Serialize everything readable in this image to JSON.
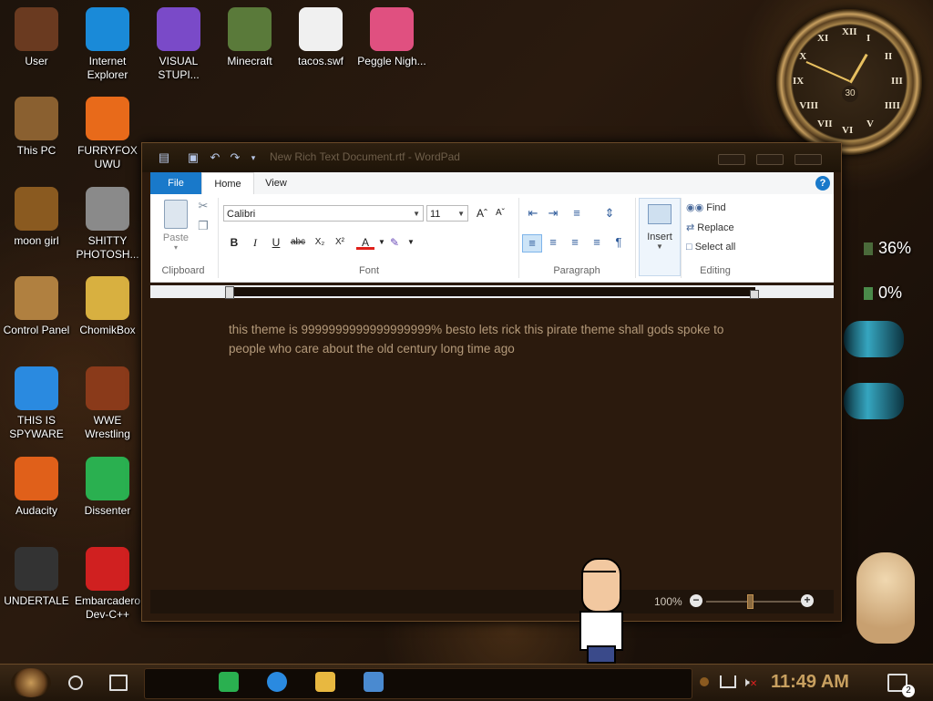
{
  "desktop_icons": [
    {
      "label": "User",
      "icon": "user-folder-icon",
      "color": "#6a3a20"
    },
    {
      "label": "Internet Explorer",
      "icon": "edge-browser-icon",
      "color": "#1a8ad8"
    },
    {
      "label": "VISUAL STUPI...",
      "icon": "visual-studio-icon",
      "color": "#7a4ac8"
    },
    {
      "label": "Minecraft",
      "icon": "minecraft-icon",
      "color": "#5a7a3a"
    },
    {
      "label": "tacos.swf",
      "icon": "flash-file-icon",
      "color": "#f0f0f0"
    },
    {
      "label": "Peggle Nigh...",
      "icon": "peggle-icon",
      "color": "#e05080"
    },
    {
      "label": "This PC",
      "icon": "computer-icon",
      "color": "#8a6030"
    },
    {
      "label": "FURRYFOX UWU",
      "icon": "firefox-icon",
      "color": "#e86a1a"
    },
    {
      "label": "moon girl",
      "icon": "folder-icon",
      "color": "#8a5a20"
    },
    {
      "label": "SHITTY PHOTOSH...",
      "icon": "gimp-icon",
      "color": "#8a8a8a"
    },
    {
      "label": "Control Panel",
      "icon": "control-panel-icon",
      "color": "#b08040"
    },
    {
      "label": "ChomikBox",
      "icon": "chomikbox-icon",
      "color": "#d8b040"
    },
    {
      "label": "THIS IS SPYWARE",
      "icon": "chrome-icon",
      "color": "#2a8ae0"
    },
    {
      "label": "WWE Wrestling",
      "icon": "wwe-icon",
      "color": "#8a3a1a"
    },
    {
      "label": "Audacity",
      "icon": "audacity-icon",
      "color": "#e0601a"
    },
    {
      "label": "Dissenter",
      "icon": "dissenter-icon",
      "color": "#2ab050"
    },
    {
      "label": "UNDERTALE",
      "icon": "unity-icon",
      "color": "#333333"
    },
    {
      "label": "Embarcadero Dev-C++",
      "icon": "devcpp-icon",
      "color": "#d02020"
    }
  ],
  "meters": {
    "cpu": "36%",
    "ram": "0%"
  },
  "wordpad": {
    "title": "New Rich Text Document.rtf - WordPad",
    "tabs": {
      "file": "File",
      "home": "Home",
      "view": "View"
    },
    "help": "?",
    "clipboard": {
      "paste": "Paste",
      "group": "Clipboard"
    },
    "font": {
      "family": "Calibri",
      "size": "11",
      "group": "Font"
    },
    "paragraph": {
      "group": "Paragraph"
    },
    "insert": {
      "label": "Insert"
    },
    "editing": {
      "find": "Find",
      "replace": "Replace",
      "select_all": "Select all",
      "group": "Editing"
    },
    "document_text": "this theme is 9999999999999999999% besto lets rick this pirate theme shall gods spoke to people who care about the old century long time ago",
    "zoom": "100%"
  },
  "clock_numbers": [
    "XII",
    "I",
    "II",
    "III",
    "IIII",
    "V",
    "VI",
    "VII",
    "VIII",
    "IX",
    "X",
    "XI"
  ],
  "clock_center": "30",
  "taskbar": {
    "time": "11:49 AM",
    "notifications": "2",
    "pinned": [
      {
        "icon": "dissenter-icon",
        "color": "#2ab050"
      },
      {
        "icon": "chrome-icon",
        "color": "#2a8ae0"
      },
      {
        "icon": "file-explorer-icon",
        "color": "#e8b840"
      },
      {
        "icon": "wordpad-icon",
        "color": "#4a8ad0"
      }
    ]
  }
}
